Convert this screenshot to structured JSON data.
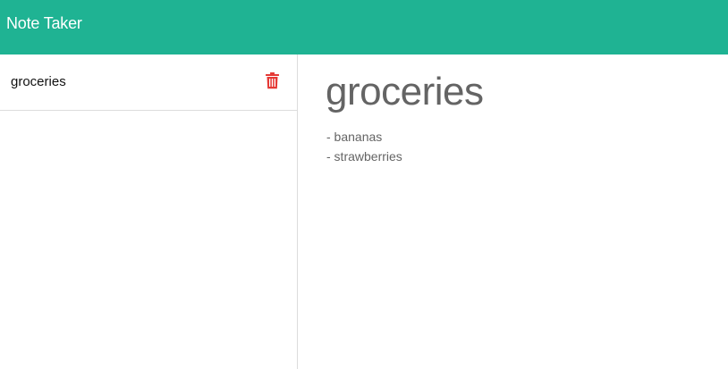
{
  "app": {
    "title": "Note Taker",
    "brand_color": "#1fb393",
    "delete_color": "#e53935"
  },
  "sidebar": {
    "notes": [
      {
        "title": "groceries",
        "action_icon": "trash-icon"
      }
    ]
  },
  "editor": {
    "title": "groceries",
    "lines": [
      "- bananas",
      "- strawberries"
    ]
  }
}
